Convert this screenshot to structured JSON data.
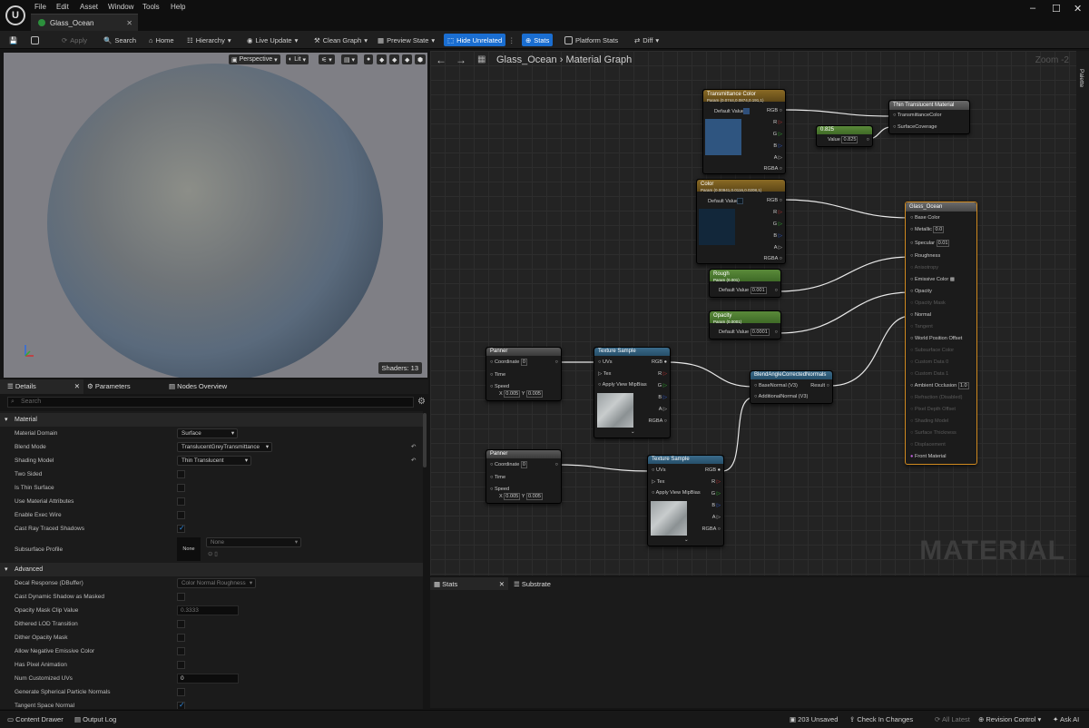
{
  "menu": [
    "File",
    "Edit",
    "Asset",
    "Window",
    "Tools",
    "Help"
  ],
  "tab": {
    "title": "Glass_Ocean"
  },
  "toolbar": {
    "apply": "Apply",
    "search": "Search",
    "home": "Home",
    "hierarchy": "Hierarchy",
    "live_update": "Live Update",
    "clean_graph": "Clean Graph",
    "preview_state": "Preview State",
    "hide_unrelated": "Hide Unrelated",
    "stats": "Stats",
    "platform_stats": "Platform Stats",
    "diff": "Diff"
  },
  "viewport": {
    "perspective": "Perspective",
    "lit": "Lit",
    "shaders": "Shaders: 13"
  },
  "panel_tabs": {
    "details": "Details",
    "parameters": "Parameters",
    "nodes_overview": "Nodes Overview"
  },
  "search": {
    "placeholder": "Search"
  },
  "details": {
    "material_cat": "Material",
    "material_domain": {
      "label": "Material Domain",
      "value": "Surface"
    },
    "blend_mode": {
      "label": "Blend Mode",
      "value": "TranslucentGreyTransmittance"
    },
    "shading_model": {
      "label": "Shading Model",
      "value": "Thin Translucent"
    },
    "two_sided": "Two Sided",
    "thin_surface": "Is Thin Surface",
    "use_attrs": "Use Material Attributes",
    "exec_wire": "Enable Exec Wire",
    "ray_shadows": "Cast Ray Traced Shadows",
    "subsurface": {
      "label": "Subsurface Profile",
      "thumb": "None",
      "value": "None"
    },
    "advanced_cat": "Advanced",
    "decal": {
      "label": "Decal Response (DBuffer)",
      "value": "Color Normal Roughness"
    },
    "dyn_shadow": "Cast Dynamic Shadow as Masked",
    "opacity_clip": {
      "label": "Opacity Mask Clip Value",
      "value": "0.3333"
    },
    "dither_lod": "Dithered LOD Transition",
    "dither_opacity": "Dither Opacity Mask",
    "neg_emissive": "Allow Negative Emissive Color",
    "pixel_anim": "Has Pixel Animation",
    "num_uvs": {
      "label": "Num Customized UVs",
      "value": "0"
    },
    "sph_normals": "Generate Spherical Particle Normals",
    "tangent_normal": "Tangent Space Normal"
  },
  "graph": {
    "title": "Glass_Ocean",
    "section": "Material Graph",
    "zoom": "Zoom -2",
    "palette": "Palette",
    "watermark": "MATERIAL"
  },
  "nodes": {
    "transmittance": {
      "title": "Transmittance Color",
      "sub": "Param (0.0744,0.0874,0.191,1)",
      "default": "Default Value",
      "outs": [
        "RGB",
        "R",
        "G",
        "B",
        "A",
        "RGBA"
      ]
    },
    "color": {
      "title": "Color",
      "sub": "Param (0.00941,0.0116,0.0208,1)",
      "default": "Default Value",
      "outs": [
        "RGB",
        "R",
        "G",
        "B",
        "A",
        "RGBA"
      ]
    },
    "const": {
      "title": "0.825",
      "label": "Value",
      "value": "0.825"
    },
    "thin": {
      "title": "Thin Translucent Material",
      "pins": [
        "TransmittanceColor",
        "SurfaceCoverage"
      ]
    },
    "rough": {
      "title": "Rough",
      "sub": "Param (0.001)",
      "label": "Default Value",
      "value": "0.001"
    },
    "opacity": {
      "title": "Opacity",
      "sub": "Param (0.0001)",
      "label": "Default Value",
      "value": "0.0001"
    },
    "main": {
      "title": "Glass_Ocean",
      "pins": [
        "Base Color",
        "Metallic",
        "Specular",
        "Roughness",
        "Anisotropy",
        "Emissive Color",
        "Opacity",
        "Opacity Mask",
        "Normal",
        "Tangent",
        "World Position Offset",
        "Subsurface Color",
        "Custom Data 0",
        "Custom Data 1",
        "Ambient Occlusion",
        "Refraction (Disabled)",
        "Pixel Depth Offset",
        "Shading Model",
        "Surface Thickness",
        "Displacement",
        "Front Material"
      ],
      "metallic": "0.0",
      "specular": "0.01",
      "ao": "1.0"
    },
    "panner1": {
      "title": "Panner",
      "pins": [
        "Coordinate",
        "Time",
        "Speed"
      ],
      "coord": "0",
      "x": "0.005",
      "y": "0.005"
    },
    "panner2": {
      "title": "Panner",
      "pins": [
        "Coordinate",
        "Time",
        "Speed"
      ],
      "coord": "0",
      "x": "0.005",
      "y": "0.005"
    },
    "tex1": {
      "title": "Texture Sample",
      "ins": [
        "UVs",
        "Tex",
        "Apply View MipBias"
      ],
      "outs": [
        "RGB",
        "R",
        "G",
        "B",
        "A",
        "RGBA"
      ]
    },
    "tex2": {
      "title": "Texture Sample",
      "ins": [
        "UVs",
        "Tex",
        "Apply View MipBias"
      ],
      "outs": [
        "RGB",
        "R",
        "G",
        "B",
        "A",
        "RGBA"
      ]
    },
    "blend": {
      "title": "BlendAngleCorrectedNormals",
      "ins": [
        "BaseNormal (V3)",
        "AdditionalNormal (V3)"
      ],
      "out": "Result"
    }
  },
  "bottom_tabs": {
    "stats": "Stats",
    "substrate": "Substrate"
  },
  "statusbar": {
    "content_drawer": "Content Drawer",
    "output_log": "Output Log",
    "unsaved": "203 Unsaved",
    "check_in": "Check In Changes",
    "all_latest": "All Latest",
    "revision": "Revision Control",
    "ask_ai": "Ask AI"
  }
}
